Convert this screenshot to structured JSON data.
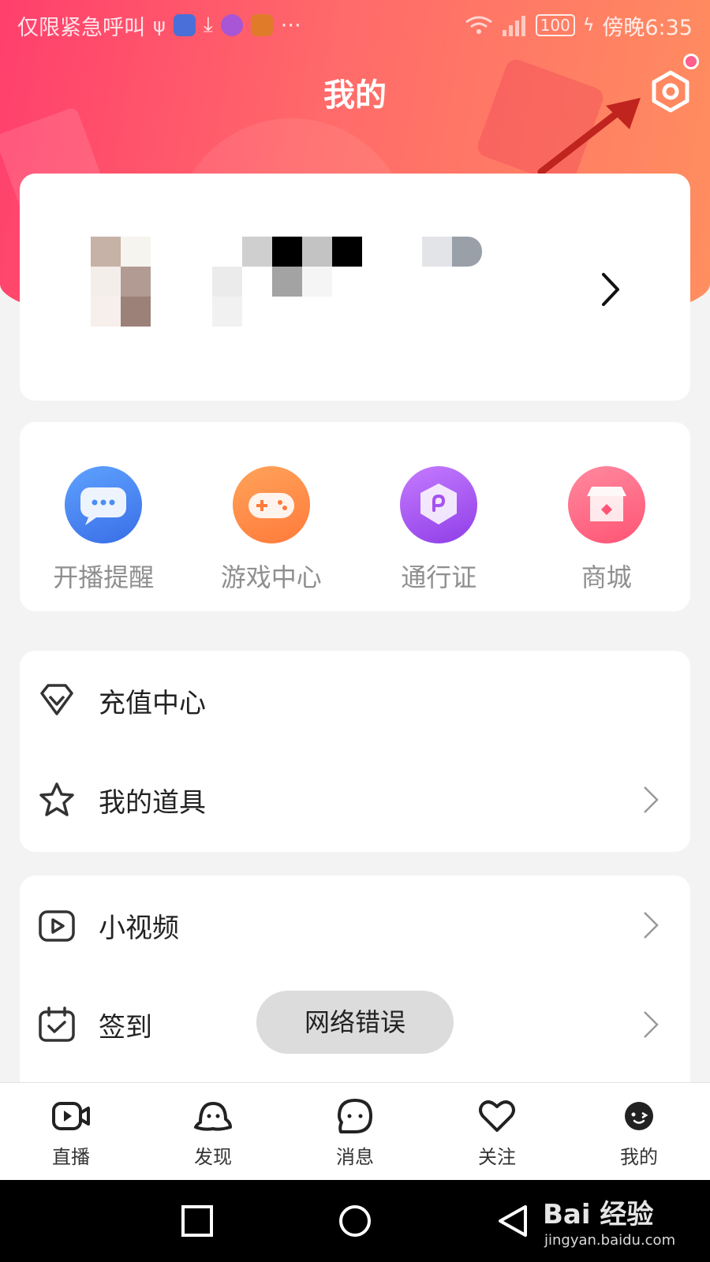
{
  "status_bar": {
    "left_text": "仅限紧急呼叫",
    "battery": "100",
    "right_text": "傍晚6:35",
    "overflow": "···"
  },
  "header": {
    "title": "我的",
    "settings_icon": "hexagon-settings-icon",
    "accent_gradient": [
      "#ff3f6c",
      "#ff8f5f"
    ]
  },
  "quick_actions": [
    {
      "label": "开播提醒",
      "icon": "chat-bubble-icon",
      "color": "#4a8df5"
    },
    {
      "label": "游戏中心",
      "icon": "gamepad-icon",
      "color": "#ff8c42"
    },
    {
      "label": "通行证",
      "icon": "shield-badge-icon",
      "color": "#b561f0"
    },
    {
      "label": "商城",
      "icon": "store-icon",
      "color": "#ff6b84"
    }
  ],
  "menu_group_1": [
    {
      "label": "充值中心",
      "icon": "diamond-heart-icon"
    },
    {
      "label": "我的道具",
      "icon": "star-outline-icon"
    }
  ],
  "menu_group_2": [
    {
      "label": "小视频",
      "icon": "video-play-icon"
    },
    {
      "label": "签到",
      "icon": "calendar-check-icon"
    }
  ],
  "toast": "网络错误",
  "tabbar": [
    {
      "label": "直播",
      "icon": "live-camera-icon"
    },
    {
      "label": "发现",
      "icon": "discover-ghost-icon"
    },
    {
      "label": "消息",
      "icon": "message-bubble-icon"
    },
    {
      "label": "关注",
      "icon": "heart-icon"
    },
    {
      "label": "我的",
      "icon": "profile-face-icon",
      "active": true
    }
  ],
  "watermark": {
    "brand": "Bai 经验",
    "url": "jingyan.baidu.com"
  }
}
